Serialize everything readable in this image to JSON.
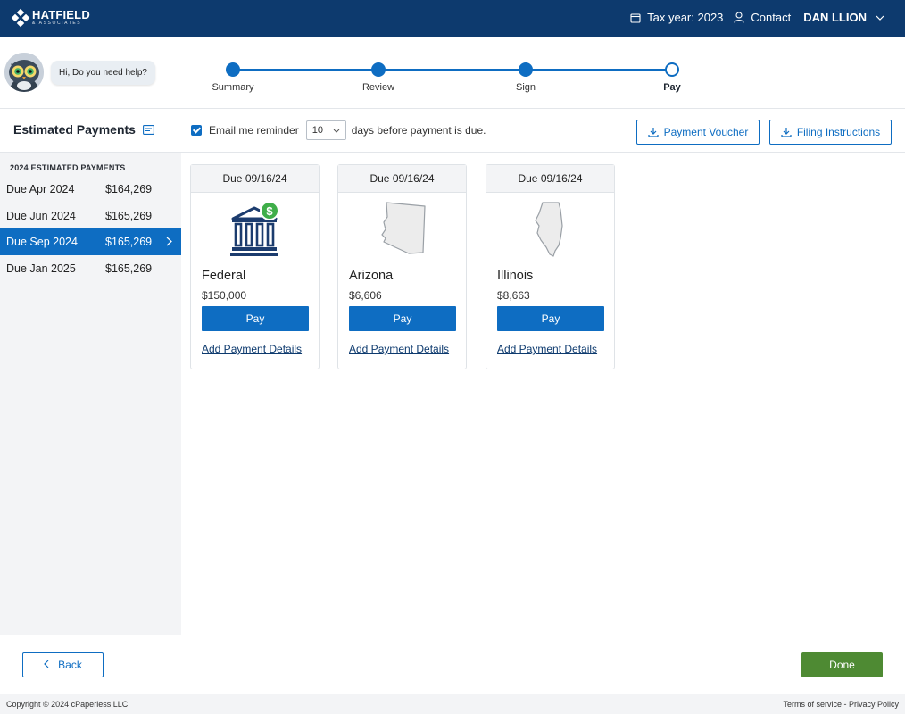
{
  "brand": {
    "name": "HATFIELD",
    "sub": "& ASSOCIATES"
  },
  "header": {
    "tax_year": "Tax year: 2023",
    "contact": "Contact",
    "user": "DAN LLION",
    "bg_color": "#0d3a6e"
  },
  "assistant": {
    "message": "Hi, Do you need help?"
  },
  "stepper": {
    "steps": [
      {
        "label": "Summary",
        "state": "complete"
      },
      {
        "label": "Review",
        "state": "complete"
      },
      {
        "label": "Sign",
        "state": "complete"
      },
      {
        "label": "Pay",
        "state": "current"
      }
    ]
  },
  "toolbar": {
    "title": "Estimated Payments",
    "reminder_checked": true,
    "reminder_prefix": "Email me reminder",
    "reminder_days": "10",
    "reminder_suffix": "days before payment is due.",
    "voucher_label": "Payment Voucher",
    "instructions_label": "Filing Instructions"
  },
  "sidebar": {
    "heading": "2024 ESTIMATED PAYMENTS",
    "items": [
      {
        "label": "Due Apr 2024",
        "amount": "$164,269",
        "active": false
      },
      {
        "label": "Due Jun 2024",
        "amount": "$165,269",
        "active": false
      },
      {
        "label": "Due Sep 2024",
        "amount": "$165,269",
        "active": true
      },
      {
        "label": "Due Jan 2025",
        "amount": "$165,269",
        "active": false
      }
    ]
  },
  "cards": [
    {
      "due": "Due 09/16/24",
      "name": "Federal",
      "amount": "$150,000",
      "icon": "bank-icon",
      "pay": "Pay",
      "link": "Add Payment Details"
    },
    {
      "due": "Due 09/16/24",
      "name": "Arizona",
      "amount": "$6,606",
      "icon": "arizona-map-icon",
      "pay": "Pay",
      "link": "Add Payment Details"
    },
    {
      "due": "Due 09/16/24",
      "name": "Illinois",
      "amount": "$8,663",
      "icon": "illinois-map-icon",
      "pay": "Pay",
      "link": "Add Payment Details"
    }
  ],
  "footer": {
    "back": "Back",
    "done": "Done",
    "copyright": "Copyright © 2024 cPaperless LLC",
    "legal": "Terms of service - Privacy Policy"
  },
  "colors": {
    "primary": "#0e6dc2",
    "done": "#4e8a33",
    "navy": "#0d3a6e"
  }
}
